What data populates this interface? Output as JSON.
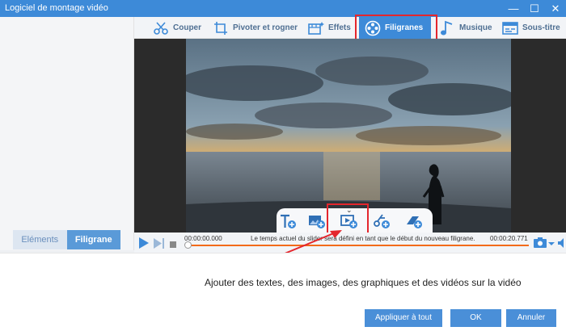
{
  "window": {
    "title": "Logiciel de montage vidéo",
    "minimize": "—",
    "maximize": "☐",
    "close": "✕"
  },
  "toolbar": {
    "items": [
      {
        "label": "Couper"
      },
      {
        "label": "Pivoter et rogner"
      },
      {
        "label": "Effets"
      },
      {
        "label": "Filigranes"
      },
      {
        "label": "Musique"
      },
      {
        "label": "Sous-titre"
      }
    ],
    "active_item": "Filigranes",
    "active_color": "#3d8ad8"
  },
  "left_panel": {
    "tabs": [
      {
        "label": "Eléments"
      },
      {
        "label": "Filigrane"
      }
    ],
    "active_tab": "Filigrane",
    "tools": [
      "lock-icon",
      "delete-icon",
      "move-up-icon",
      "move-down-icon"
    ]
  },
  "watermark_tools": [
    "add-text-icon",
    "add-image-icon",
    "add-video-icon",
    "add-shape-icon",
    "add-graphic-icon"
  ],
  "player": {
    "time_start": "00:00:00.000",
    "time_end": "00:00:20.771",
    "hint": "Le temps actuel du slider sera défini en tant que le début du nouveau filigrane.",
    "progress": 0.0,
    "progress_color": "#f36b1a"
  },
  "description": "Ajouter des textes, des images, des graphiques et des vidéos sur la vidéo",
  "buttons": {
    "apply_all": "Appliquer à tout",
    "ok": "OK",
    "cancel": "Annuler"
  }
}
